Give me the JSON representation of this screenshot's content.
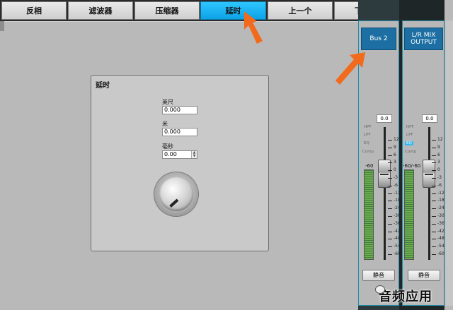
{
  "tabs": {
    "invert": "反相",
    "filter": "滤波器",
    "compressor": "压缩器",
    "delay": "延时",
    "previous": "上一个",
    "next": "下一个"
  },
  "delay_panel": {
    "title": "延时",
    "feet_label": "英尺",
    "feet_value": "0.000",
    "meters_label": "米",
    "meters_value": "0.000",
    "ms_label": "毫秒",
    "ms_value": "0.00"
  },
  "strips": {
    "bus2": {
      "name": "Bus 2",
      "value": "0.0",
      "processing": [
        "HPF",
        "LPF",
        "EQ",
        "Comp"
      ],
      "meter_label": "-60",
      "mute": "静音"
    },
    "lr_mix": {
      "name_line1": "L/R MIX",
      "name_line2": "OUTPUT",
      "value": "0.0",
      "processing": [
        "HPF",
        "LPF",
        "EQ",
        "Comp"
      ],
      "eq_active": true,
      "meter_label": "-60/-60",
      "mute": "静音"
    }
  },
  "fader_scale": [
    "12",
    "9",
    "6",
    "3",
    "0",
    "-3",
    "-6",
    "-12",
    "-18",
    "-24",
    "-30",
    "-36",
    "-42",
    "-48",
    "-54",
    "-60"
  ],
  "watermark": "音频应用",
  "colors": {
    "active_tab": "#1aa9ea",
    "bus_button": "#1d6fa3",
    "arrow": "#f26a1b",
    "strip_border": "#1f8fa8"
  }
}
